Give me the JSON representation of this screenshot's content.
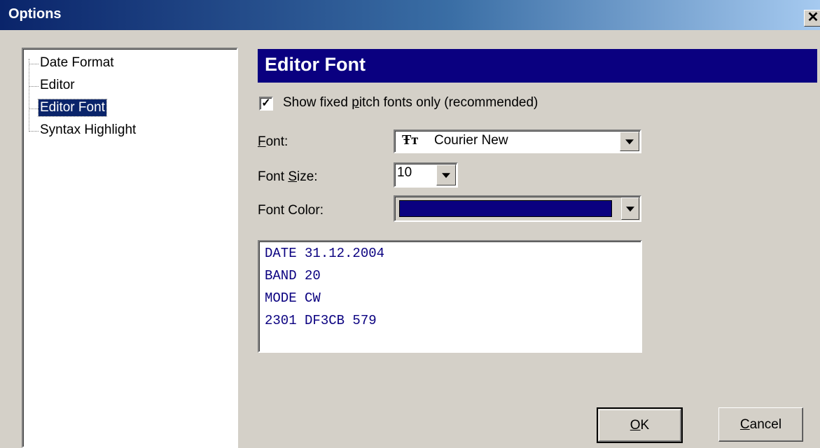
{
  "window": {
    "title": "Options",
    "close_glyph": "✕"
  },
  "tree": {
    "items": [
      {
        "label": "Date Format",
        "selected": false
      },
      {
        "label": "Editor",
        "selected": false
      },
      {
        "label": "Editor Font",
        "selected": true
      },
      {
        "label": "Syntax Highlight",
        "selected": false
      }
    ]
  },
  "panel": {
    "header": "Editor Font",
    "checkbox": {
      "checked": true,
      "label_before": "Show fixed ",
      "label_mnemonic": "p",
      "label_after": "itch fonts only (recommended)"
    },
    "font": {
      "label_mnemonic": "F",
      "label_rest": "ont:",
      "value": "Courier New",
      "icon": "truetype-font-icon"
    },
    "font_size": {
      "label_before": "Font ",
      "label_mnemonic": "S",
      "label_after": "ize:",
      "value": "10"
    },
    "font_color": {
      "label": "Font Color:",
      "value": "#0a0080"
    },
    "preview_lines": [
      "DATE 31.12.2004",
      "BAND 20",
      "MODE CW",
      "2301 DF3CB 579"
    ]
  },
  "buttons": {
    "ok": {
      "mnemonic": "O",
      "rest": "K"
    },
    "cancel": {
      "mnemonic": "C",
      "rest": "ancel"
    }
  }
}
